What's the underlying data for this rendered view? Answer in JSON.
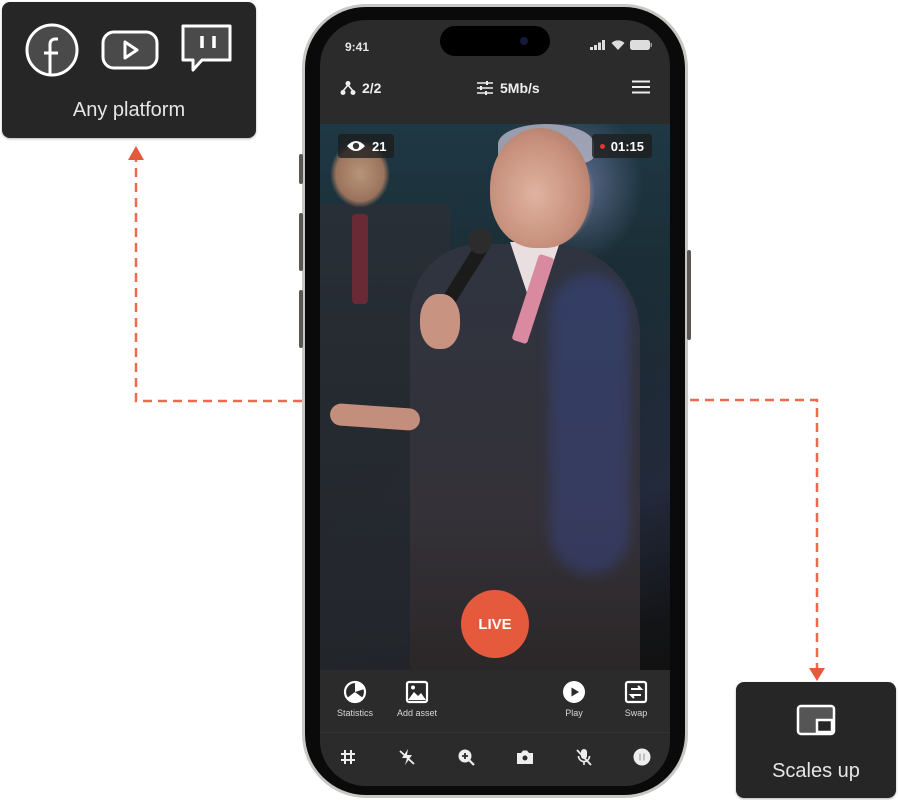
{
  "callouts": {
    "platforms": {
      "label": "Any platform",
      "icons": [
        "facebook-icon",
        "youtube-icon",
        "twitch-icon"
      ]
    },
    "scale": {
      "label": "Scales up",
      "icon": "picture-in-picture-icon"
    }
  },
  "colors": {
    "accent": "#e55a3d",
    "connector": "#ee6a4f",
    "callout_bg": "#262626",
    "app_bg": "#2b2b2b"
  },
  "phone": {
    "status_bar": {
      "time": "9:41",
      "icons": [
        "signal-icon",
        "wifi-icon",
        "battery-icon"
      ]
    },
    "toolbar": {
      "destinations": "2/2",
      "bitrate": "5Mb/s",
      "menu_icon": "hamburger-menu-icon"
    },
    "video": {
      "viewers": "21",
      "duration": "01:15"
    },
    "live_button": "LIVE",
    "actions": [
      {
        "label": "Statistics",
        "icon": "statistics-icon"
      },
      {
        "label": "Add asset",
        "icon": "image-icon"
      },
      {
        "label": "Play",
        "icon": "play-icon"
      },
      {
        "label": "Swap",
        "icon": "swap-icon"
      }
    ],
    "bottom_controls": [
      "grid-icon",
      "flash-off-icon",
      "zoom-in-icon",
      "camera-icon",
      "mic-off-icon",
      "pause-icon"
    ]
  }
}
